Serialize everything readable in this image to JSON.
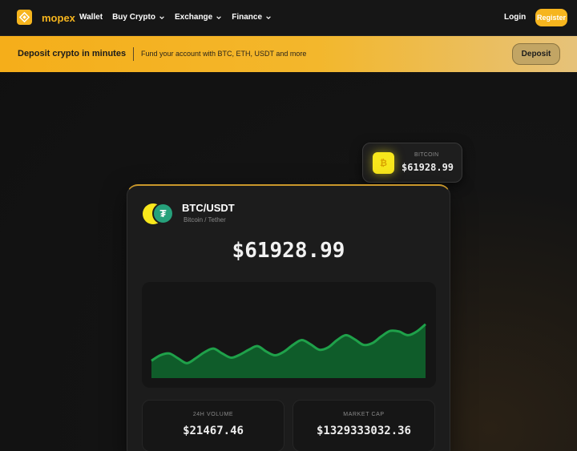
{
  "nav": {
    "brand": "mopex",
    "links": [
      {
        "label": "Wallet",
        "dropdown": false
      },
      {
        "label": "Buy Crypto",
        "dropdown": true
      },
      {
        "label": "Exchange",
        "dropdown": true
      },
      {
        "label": "Finance",
        "dropdown": true
      }
    ],
    "login_label": "Login",
    "register_label": "Register"
  },
  "banner": {
    "title": "Deposit crypto in minutes",
    "subtitle": "Fund your account with BTC, ETH, USDT and more",
    "button_label": "Deposit"
  },
  "ticker": {
    "label": "BITCOIN",
    "price": "$61928.99",
    "coin_icon": "bitcoin-icon",
    "coin_glyph": "₿"
  },
  "card": {
    "pair": "BTC/USDT",
    "pair_subtitle": "Bitcoin / Tether",
    "usdt_glyph": "₮",
    "price": "$61928.99",
    "stats": {
      "volume_label": "24H VOLUME",
      "volume_value": "$21467.46",
      "cap_label": "MARKET CAP",
      "cap_value": "$1329333032.36"
    }
  },
  "chart_data": {
    "type": "area",
    "series": [
      {
        "values": [
          0.18,
          0.27,
          0.3,
          0.22,
          0.14,
          0.22,
          0.32,
          0.38,
          0.3,
          0.23,
          0.28,
          0.36,
          0.42,
          0.33,
          0.27,
          0.33,
          0.44,
          0.52,
          0.45,
          0.36,
          0.4,
          0.52,
          0.6,
          0.53,
          0.44,
          0.47,
          0.58,
          0.67,
          0.66,
          0.6,
          0.66,
          0.78
        ]
      }
    ],
    "line_color": "#1fa14a",
    "fill_color": "#0f5c2a",
    "grid": false
  },
  "colors": {
    "accent": "#f6b51e",
    "banner_start": "#f5ae1a",
    "banner_end": "#e6c27a",
    "positive": "#1fa14a"
  }
}
